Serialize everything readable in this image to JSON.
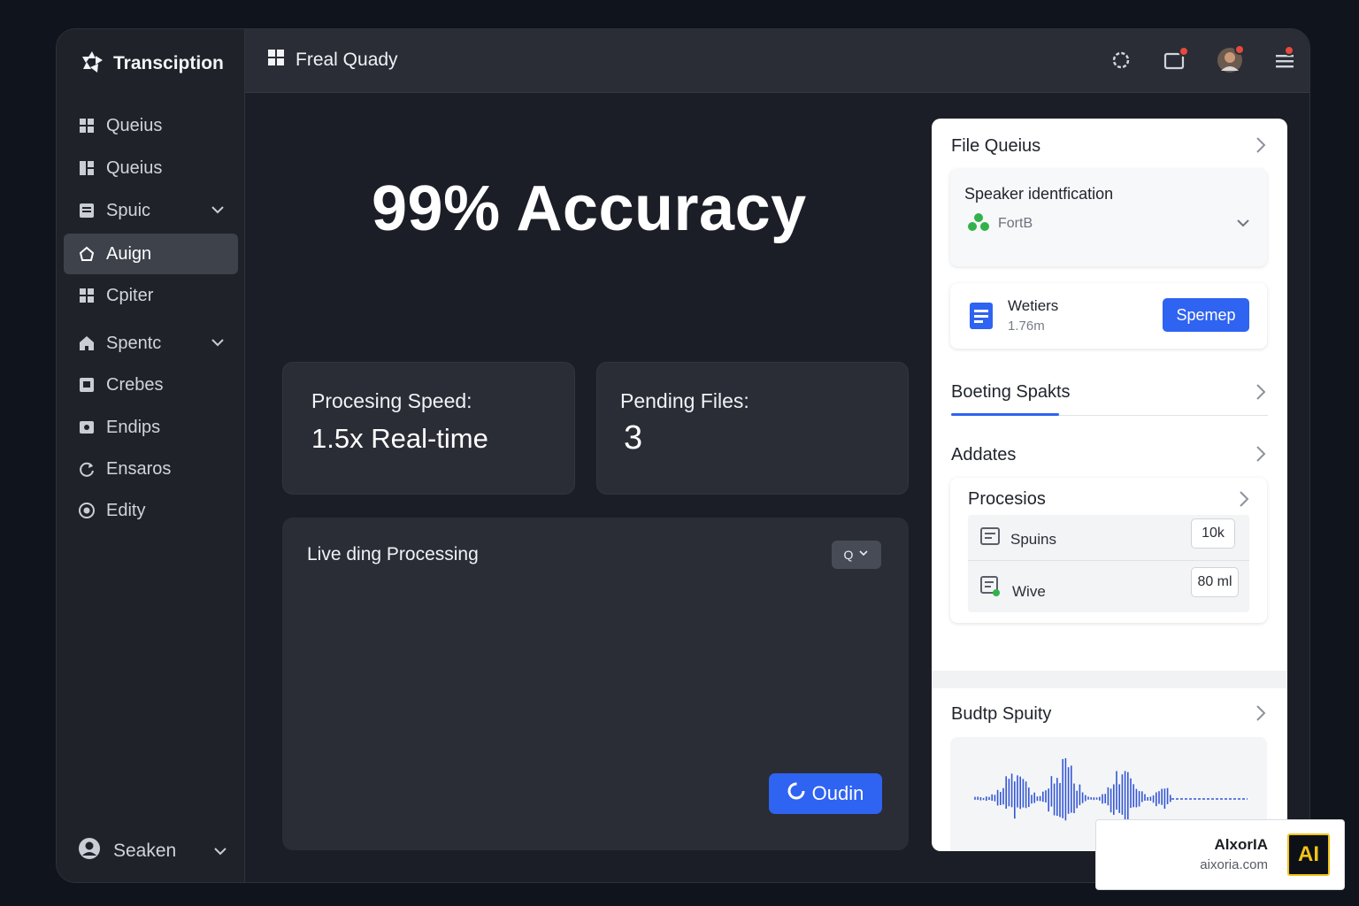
{
  "sidebar": {
    "brand": "Transciption",
    "items": [
      {
        "label": "Queius",
        "icon": "grid-icon",
        "active": false,
        "expandable": false
      },
      {
        "label": "Queius",
        "icon": "layout-icon",
        "active": false,
        "expandable": false
      },
      {
        "label": "Spuic",
        "icon": "list-icon",
        "active": false,
        "expandable": true
      },
      {
        "label": "Auign",
        "icon": "home-icon",
        "active": true,
        "expandable": false
      },
      {
        "label": "Cpiter",
        "icon": "grid-icon",
        "active": false,
        "expandable": false
      },
      {
        "label": "Spentc",
        "icon": "house-icon",
        "active": false,
        "expandable": true
      },
      {
        "label": "Crebes",
        "icon": "box-icon",
        "active": false,
        "expandable": false
      },
      {
        "label": "Endips",
        "icon": "image-icon",
        "active": false,
        "expandable": false
      },
      {
        "label": "Ensaros",
        "icon": "refresh-icon",
        "active": false,
        "expandable": false
      },
      {
        "label": "Edity",
        "icon": "target-icon",
        "active": false,
        "expandable": false
      }
    ],
    "user": {
      "label": "Seaken",
      "icon": "user-avatar-icon"
    }
  },
  "topbar": {
    "title": "Freal Quady",
    "icons": [
      "settings-icon",
      "notification-icon",
      "avatar",
      "menu-icon"
    ]
  },
  "main": {
    "headline": "99% Accuracy",
    "cards": [
      {
        "label": "Procesing Speed:",
        "value": "1.5x Real-time"
      },
      {
        "label": "Pending Files:",
        "value": "3"
      }
    ],
    "waveform": {
      "title": "Live ding Processing",
      "dropdown_value": "Q",
      "button_label": "Oudin"
    }
  },
  "panel": {
    "file_queue": {
      "title": "File Queius"
    },
    "speaker": {
      "title": "Speaker identfication",
      "value": "FortB"
    },
    "file_item": {
      "name": "Wetiers",
      "meta": "1.76m",
      "button": "Spemep"
    },
    "tab": {
      "title": "Boeting Spakts"
    },
    "addates": {
      "title": "Addates"
    },
    "procesios": {
      "title": "Procesios",
      "rows": [
        {
          "label": "Spuins",
          "value": "10k"
        },
        {
          "label": "Wive",
          "value": "80 ml"
        }
      ]
    },
    "budtp": {
      "title": "Budtp Spuity"
    }
  },
  "watermark": {
    "name": "AlxorIA",
    "url": "aixoria.com",
    "logo": "AI"
  },
  "colors": {
    "accent": "#2f63f1",
    "background": "#10141c",
    "wave": "#5fb0d8",
    "panel_wave": "#3457d5"
  }
}
